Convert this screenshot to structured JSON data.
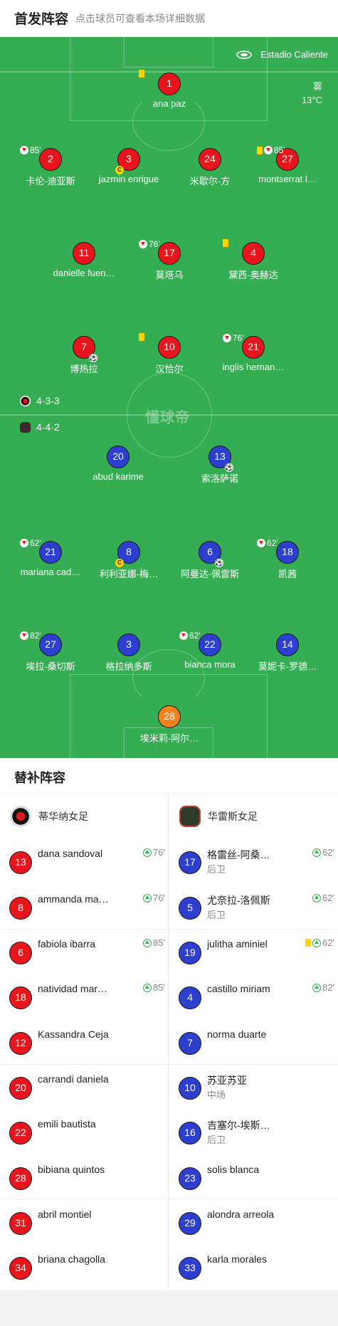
{
  "header": {
    "title": "首发阵容",
    "subtitle": "点击球员可查看本场详细数据"
  },
  "pitch": {
    "stadium": "Estadio Caliente",
    "weather": "雾",
    "temperature": "13°C",
    "watermark": "懂球帝",
    "home_formation": "4-3-3",
    "away_formation": "4-4-2"
  },
  "home_players": [
    {
      "number": "1",
      "name": "ana paz",
      "yellow_card": true
    },
    {
      "number": "2",
      "name": "卡伦-迪亚斯",
      "sub_out": "85'"
    },
    {
      "number": "3",
      "name": "jazmin enrigue",
      "captain": "C"
    },
    {
      "number": "24",
      "name": "米歇尔-方"
    },
    {
      "number": "27",
      "name": "montserrat l…",
      "yellow_card": true,
      "sub_out": "85'"
    },
    {
      "number": "11",
      "name": "danielle fuen…"
    },
    {
      "number": "17",
      "name": "莫塔乌",
      "sub_out": "76'"
    },
    {
      "number": "4",
      "name": "黛西-奥赫达",
      "yellow_card": true
    },
    {
      "number": "7",
      "name": "博热拉",
      "goal": true
    },
    {
      "number": "10",
      "name": "汉恰尔",
      "yellow_card": true
    },
    {
      "number": "21",
      "name": "inglis hernan…",
      "sub_out": "76'"
    }
  ],
  "away_players": [
    {
      "number": "20",
      "name": "abud karime"
    },
    {
      "number": "13",
      "name": "索洛萨诺",
      "goal": true
    },
    {
      "number": "21",
      "name": "mariana cad…",
      "sub_out": "62'"
    },
    {
      "number": "8",
      "name": "利利亚娜-梅…",
      "captain": "C"
    },
    {
      "number": "6",
      "name": "阿曼达-佩雷斯",
      "goal": true
    },
    {
      "number": "18",
      "name": "凯茜",
      "sub_out": "62'"
    },
    {
      "number": "27",
      "name": "埃拉-桑切斯",
      "sub_out": "82'"
    },
    {
      "number": "3",
      "name": "格拉纳多斯"
    },
    {
      "number": "22",
      "name": "bianca mora",
      "sub_out": "62'"
    },
    {
      "number": "14",
      "name": "莫妮卡-罗德…"
    },
    {
      "number": "28",
      "name": "埃米莉-阿尔…"
    }
  ],
  "substitutes": {
    "title": "替补阵容",
    "home_team": "蒂华纳女足",
    "away_team": "华雷斯女足",
    "home": [
      {
        "number": "13",
        "name": "dana sandoval",
        "sub_in": "76'"
      },
      {
        "number": "8",
        "name": "ammanda ma…",
        "sub_in": "76'"
      },
      {
        "number": "6",
        "name": "fabiola ibarra",
        "sub_in": "85'"
      },
      {
        "number": "18",
        "name": "natividad mar…",
        "sub_in": "85'"
      },
      {
        "number": "12",
        "name": "Kassandra Ceja"
      },
      {
        "number": "20",
        "name": "carrandi daniela"
      },
      {
        "number": "22",
        "name": "emili bautista"
      },
      {
        "number": "28",
        "name": "bibiana quintos"
      },
      {
        "number": "31",
        "name": "abril montiel"
      },
      {
        "number": "34",
        "name": "briana chagolla"
      }
    ],
    "away": [
      {
        "number": "17",
        "name": "格雷丝-阿桑…",
        "position": "后卫",
        "sub_in": "62'"
      },
      {
        "number": "5",
        "name": "尤奈拉-洛佩斯",
        "position": "后卫",
        "sub_in": "62'"
      },
      {
        "number": "19",
        "name": "julitha aminiel",
        "yellow_card": true,
        "sub_in": "62'"
      },
      {
        "number": "4",
        "name": "castillo miriam",
        "sub_in": "82'"
      },
      {
        "number": "7",
        "name": "norma duarte"
      },
      {
        "number": "10",
        "name": "苏亚苏亚",
        "position": "中场"
      },
      {
        "number": "16",
        "name": "吉塞尔-埃斯…",
        "position": "后卫"
      },
      {
        "number": "23",
        "name": "solis blanca"
      },
      {
        "number": "29",
        "name": "alondra arreola"
      },
      {
        "number": "33",
        "name": "karla morales"
      }
    ]
  },
  "colors": {
    "home": "#e8161c",
    "away": "#2c3fcf",
    "keeper_away": "#f5821f",
    "pitch": "#35ad52"
  }
}
